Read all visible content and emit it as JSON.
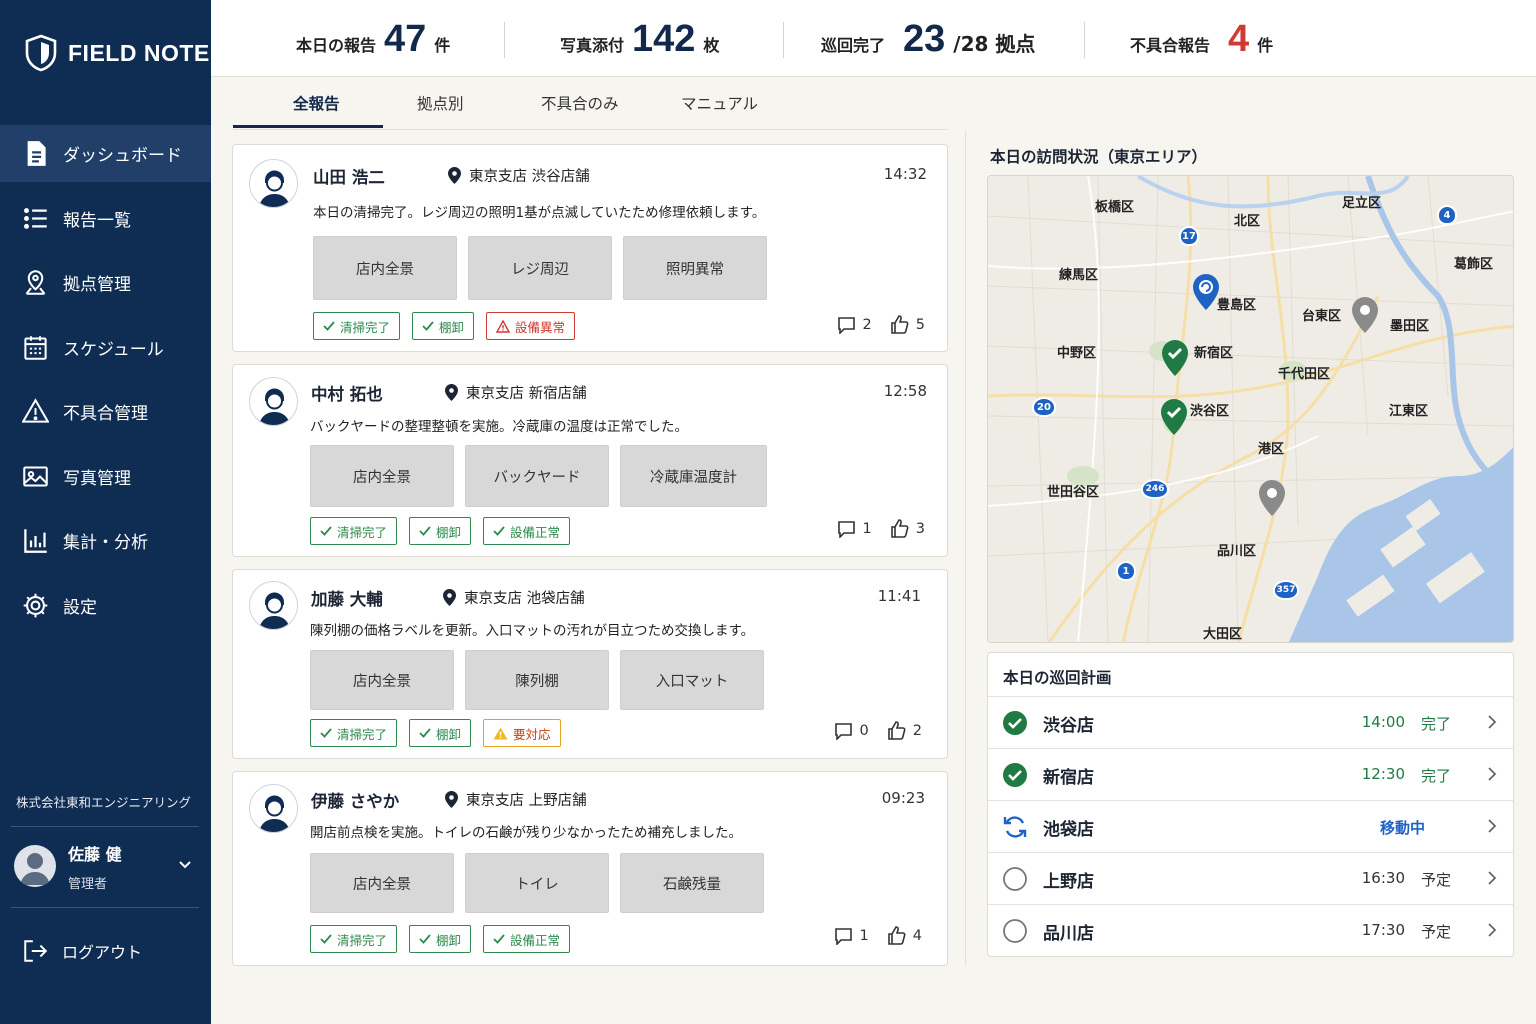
{
  "brand": {
    "name": "FIELD NOTE"
  },
  "sidebar": {
    "items": [
      {
        "label": "ダッシュボード",
        "icon": "document-icon"
      },
      {
        "label": "報告一覧",
        "icon": "list-icon"
      },
      {
        "label": "拠点管理",
        "icon": "location-user-icon"
      },
      {
        "label": "スケジュール",
        "icon": "calendar-icon"
      },
      {
        "label": "不具合管理",
        "icon": "warning-icon"
      },
      {
        "label": "写真管理",
        "icon": "image-icon"
      },
      {
        "label": "集計・分析",
        "icon": "bar-chart-icon"
      },
      {
        "label": "設定",
        "icon": "gear-icon"
      }
    ],
    "company": "株式会社東和エンジニアリング",
    "user": {
      "name": "佐藤 健",
      "role": "管理者"
    },
    "logout": "ログアウト"
  },
  "stats": [
    {
      "label": "本日の報告",
      "value": "47",
      "unit": "件"
    },
    {
      "label": "写真添付",
      "value": "142",
      "unit": "枚"
    },
    {
      "label": "巡回完了",
      "value": "23",
      "unit": "/28 拠点"
    },
    {
      "label": "不具合報告",
      "value": "4",
      "unit": "件"
    }
  ],
  "tabs": [
    "全報告",
    "拠点別",
    "不具合のみ",
    "マニュアル"
  ],
  "reports": [
    {
      "name": "山田 浩二",
      "location": "東京支店 渋谷店舗",
      "time": "14:32",
      "body": "本日の清掃完了。レジ周辺の照明1基が点滅していたため修理依頼します。",
      "photos": [
        "店内全景",
        "レジ周辺",
        "照明異常"
      ],
      "tags": [
        "清掃完了",
        "棚卸",
        "設備異常"
      ],
      "comments": "2",
      "likes": "5"
    },
    {
      "name": "中村 拓也",
      "location": "東京支店 新宿店舗",
      "time": "12:58",
      "body": "バックヤードの整理整頓を実施。冷蔵庫の温度は正常でした。",
      "photos": [
        "店内全景",
        "バックヤード",
        "冷蔵庫温度計"
      ],
      "tags": [
        "清掃完了",
        "棚卸",
        "設備正常"
      ],
      "comments": "1",
      "likes": "3"
    },
    {
      "name": "加藤 大輔",
      "location": "東京支店 池袋店舗",
      "time": "11:41",
      "body": "陳列棚の価格ラベルを更新。入口マットの汚れが目立つため交換します。",
      "photos": [
        "店内全景",
        "陳列棚",
        "入口マット"
      ],
      "tags": [
        "清掃完了",
        "棚卸",
        "要対応"
      ],
      "comments": "0",
      "likes": "2"
    },
    {
      "name": "伊藤 さやか",
      "location": "東京支店 上野店舗",
      "time": "09:23",
      "body": "開店前点検を実施。トイレの石鹸が残り少なかったため補充しました。",
      "photos": [
        "店内全景",
        "トイレ",
        "石鹸残量"
      ],
      "tags": [
        "清掃完了",
        "棚卸",
        "設備正常"
      ],
      "comments": "1",
      "likes": "4"
    }
  ],
  "map": {
    "title": "本日の訪問状況（東京エリア）",
    "labels": [
      "板橋区",
      "北区",
      "足立区",
      "葛飾区",
      "練馬区",
      "豊島区",
      "台東区",
      "墨田区",
      "中野区",
      "新宿区",
      "千代田区",
      "渋谷区",
      "江東区",
      "港区",
      "世田谷区",
      "品川区",
      "大田区"
    ],
    "routes": [
      "17",
      "4",
      "20",
      "246",
      "1",
      "357"
    ]
  },
  "plan": {
    "title": "本日の巡回計画",
    "rows": [
      {
        "name": "渋谷店",
        "time": "14:00",
        "status": "完了"
      },
      {
        "name": "新宿店",
        "time": "12:30",
        "status": "完了"
      },
      {
        "name": "池袋店",
        "time": "",
        "status": "移動中"
      },
      {
        "name": "上野店",
        "time": "16:30",
        "status": "予定"
      },
      {
        "name": "品川店",
        "time": "17:30",
        "status": "予定"
      }
    ]
  },
  "colors": {
    "sidebar": "#0f2c52",
    "accent": "#13294b",
    "success": "#1f7a43",
    "danger": "#d13a32",
    "warning": "#e3a321",
    "info": "#1e63c4"
  }
}
